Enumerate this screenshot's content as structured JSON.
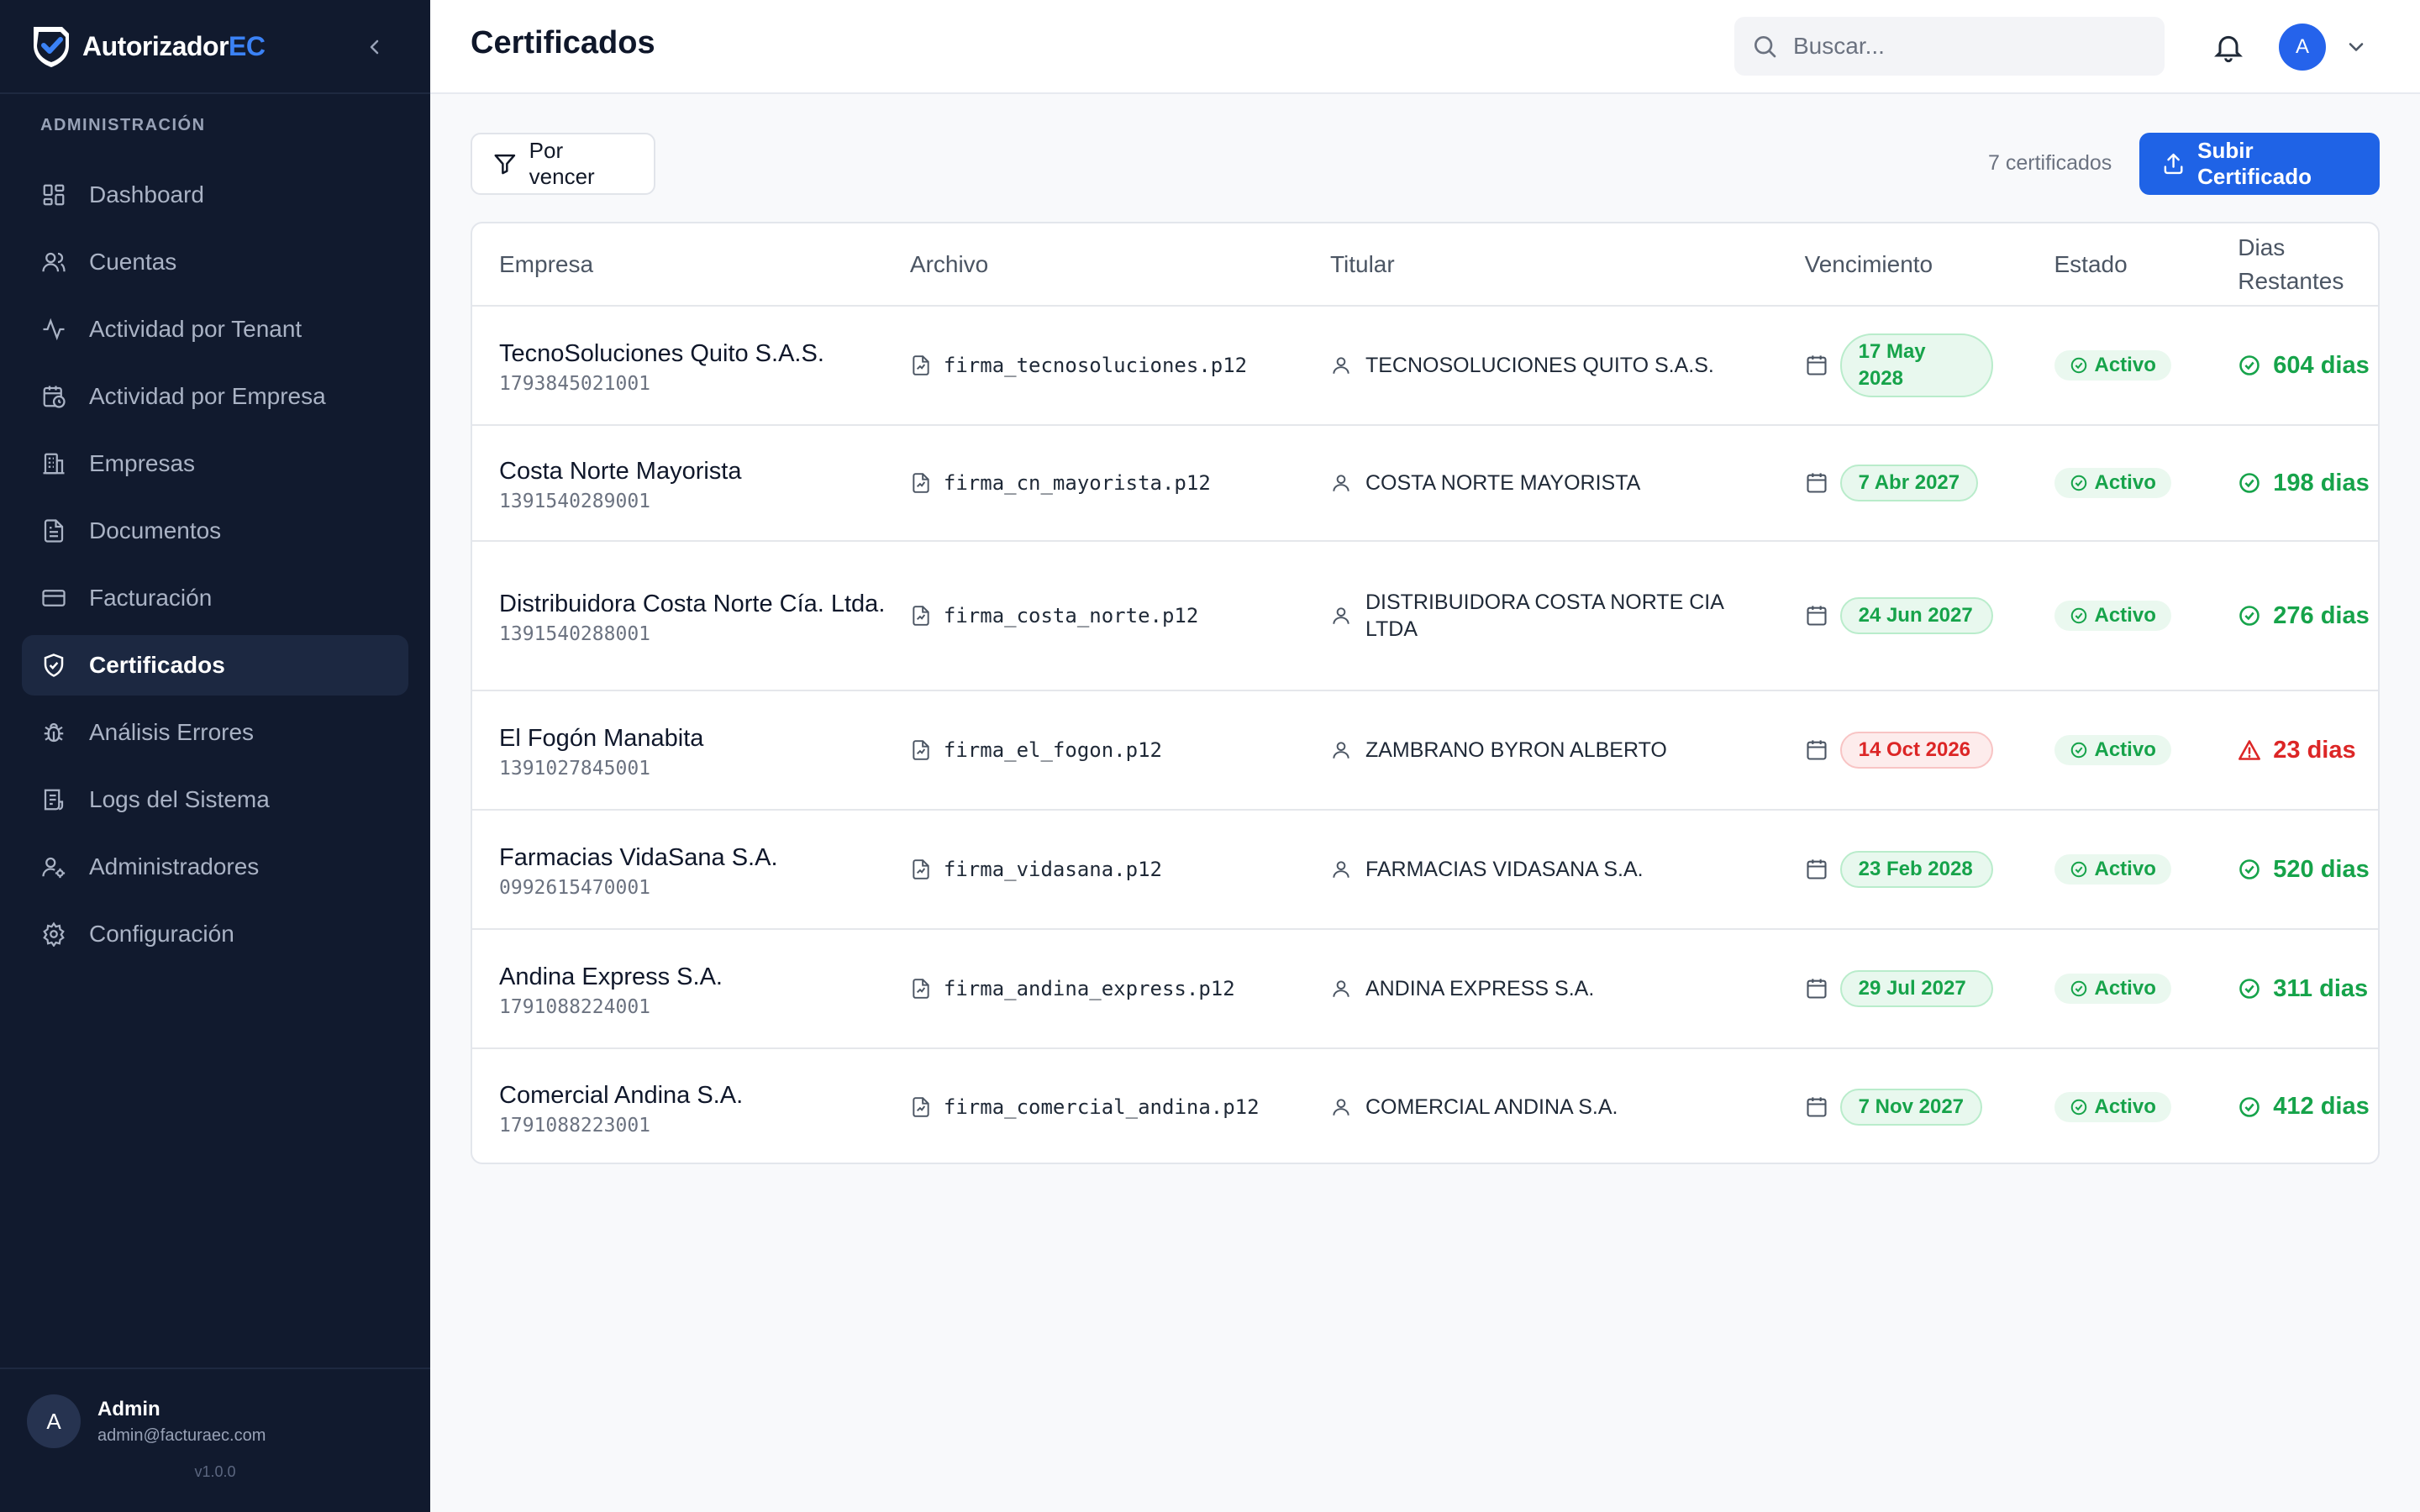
{
  "brand": {
    "name_main": "Autorizador",
    "name_accent": "EC"
  },
  "sidebar": {
    "section_label": "ADMINISTRACIÓN",
    "items": [
      {
        "label": "Dashboard",
        "icon": "dashboard-icon"
      },
      {
        "label": "Cuentas",
        "icon": "users-icon"
      },
      {
        "label": "Actividad por Tenant",
        "icon": "activity-icon"
      },
      {
        "label": "Actividad por Empresa",
        "icon": "calendar-clock-icon"
      },
      {
        "label": "Empresas",
        "icon": "building-icon"
      },
      {
        "label": "Documentos",
        "icon": "document-icon"
      },
      {
        "label": "Facturación",
        "icon": "credit-card-icon"
      },
      {
        "label": "Certificados",
        "icon": "shield-check-icon",
        "active": true
      },
      {
        "label": "Análisis Errores",
        "icon": "bug-icon"
      },
      {
        "label": "Logs del Sistema",
        "icon": "logs-icon"
      },
      {
        "label": "Administradores",
        "icon": "user-cog-icon"
      },
      {
        "label": "Configuración",
        "icon": "gear-icon"
      }
    ],
    "user": {
      "initial": "A",
      "name": "Admin",
      "email": "admin@facturaec.com"
    },
    "version": "v1.0.0"
  },
  "header": {
    "title": "Certificados",
    "search_placeholder": "Buscar...",
    "avatar_initial": "A"
  },
  "toolbar": {
    "filter_label": "Por vencer",
    "count_text": "7 certificados",
    "upload_label": "Subir Certificado"
  },
  "table": {
    "columns": [
      "Empresa",
      "Archivo",
      "Titular",
      "Vencimiento",
      "Estado",
      "Dias Restantes"
    ],
    "rows": [
      {
        "empresa": "TecnoSoluciones Quito S.A.S.",
        "ruc": "1793845021001",
        "archivo": "firma_tecnosoluciones.p12",
        "titular": "TECNOSOLUCIONES QUITO S.A.S.",
        "vencimiento": "17 May 2028",
        "estado": "Activo",
        "dias": "604 dias",
        "warning": false
      },
      {
        "empresa": "Costa Norte Mayorista",
        "ruc": "1391540289001",
        "archivo": "firma_cn_mayorista.p12",
        "titular": "COSTA NORTE MAYORISTA",
        "vencimiento": "7 Abr 2027",
        "estado": "Activo",
        "dias": "198 dias",
        "warning": false
      },
      {
        "empresa": "Distribuidora Costa Norte Cía. Ltda.",
        "ruc": "1391540288001",
        "archivo": "firma_costa_norte.p12",
        "titular": "DISTRIBUIDORA COSTA NORTE CIA LTDA",
        "vencimiento": "24 Jun 2027",
        "estado": "Activo",
        "dias": "276 dias",
        "warning": false
      },
      {
        "empresa": "El Fogón Manabita",
        "ruc": "1391027845001",
        "archivo": "firma_el_fogon.p12",
        "titular": "ZAMBRANO BYRON ALBERTO",
        "vencimiento": "14 Oct 2026",
        "estado": "Activo",
        "dias": "23 dias",
        "warning": true
      },
      {
        "empresa": "Farmacias VidaSana S.A.",
        "ruc": "0992615470001",
        "archivo": "firma_vidasana.p12",
        "titular": "FARMACIAS VIDASANA S.A.",
        "vencimiento": "23 Feb 2028",
        "estado": "Activo",
        "dias": "520 dias",
        "warning": false
      },
      {
        "empresa": "Andina Express S.A.",
        "ruc": "1791088224001",
        "archivo": "firma_andina_express.p12",
        "titular": "ANDINA EXPRESS S.A.",
        "vencimiento": "29 Jul 2027",
        "estado": "Activo",
        "dias": "311 dias",
        "warning": false
      },
      {
        "empresa": "Comercial Andina S.A.",
        "ruc": "1791088223001",
        "archivo": "firma_comercial_andina.p12",
        "titular": "COMERCIAL ANDINA S.A.",
        "vencimiento": "7 Nov 2027",
        "estado": "Activo",
        "dias": "412 dias",
        "warning": false
      }
    ]
  },
  "colors": {
    "sidebar_bg": "#111a2e",
    "accent": "#1f63e6",
    "success": "#16a34a",
    "danger": "#dc2626"
  }
}
